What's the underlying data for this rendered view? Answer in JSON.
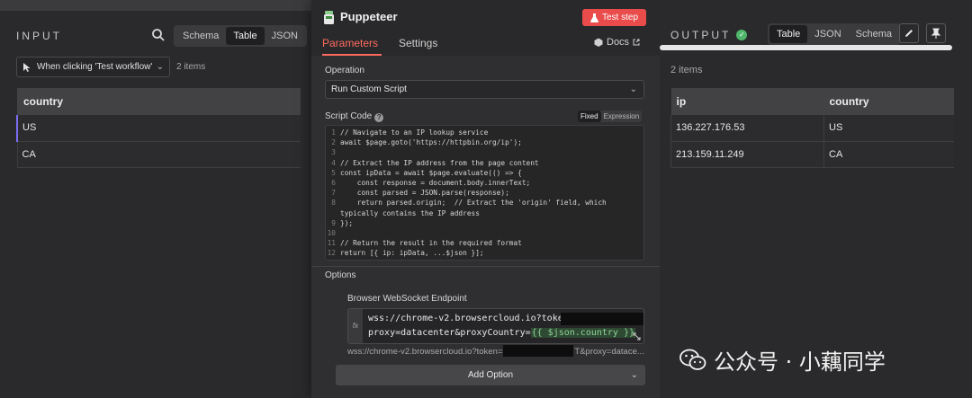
{
  "input": {
    "title": "INPUT",
    "view_tabs": [
      "Schema",
      "Table",
      "JSON"
    ],
    "active_view": "Table",
    "trigger_select": "When clicking 'Test workflow'",
    "items_count": "2 items",
    "columns": [
      "country"
    ],
    "rows": [
      [
        "US"
      ],
      [
        "CA"
      ]
    ]
  },
  "node": {
    "title": "Puppeteer",
    "test_button": "Test step",
    "tabs": {
      "parameters": "Parameters",
      "settings": "Settings"
    },
    "active_tab": "Parameters",
    "docs": "Docs",
    "operation_label": "Operation",
    "operation_value": "Run Custom Script",
    "script_label": "Script Code",
    "mode_toggle": {
      "fixed": "Fixed",
      "expression": "Expression"
    },
    "active_mode": "Fixed",
    "code_lines": [
      "// Navigate to an IP lookup service",
      "await $page.goto('https://httpbin.org/ip');",
      "",
      "// Extract the IP address from the page content",
      "const ipData = await $page.evaluate(() => {",
      "    const response = document.body.innerText;",
      "    const parsed = JSON.parse(response);",
      "    return parsed.origin;  // Extract the 'origin' field, which",
      "typically contains the IP address",
      "});",
      "",
      "// Return the result in the required format",
      "return [{ ip: ipData, ...$json }];"
    ],
    "line_numbers": [
      "1",
      "2",
      "3",
      "4",
      "5",
      "6",
      "7",
      "8",
      "",
      "9",
      "10",
      "11",
      "12"
    ],
    "options_label": "Options",
    "ws_label": "Browser WebSocket Endpoint",
    "ws_line1": "wss://chrome-v2.browsercloud.io?token=",
    "ws_line2_prefix": "proxy=datacenter&proxyCountry=",
    "ws_line2_token": "{{ $json.country }}",
    "ws_preview_a": "wss://chrome-v2.browsercloud.io?token=",
    "ws_preview_b": "T&proxy=datace...",
    "add_option": "Add Option"
  },
  "output": {
    "title": "OUTPUT",
    "view_tabs": [
      "Table",
      "JSON",
      "Schema"
    ],
    "active_view": "Table",
    "items_count": "2 items",
    "columns": [
      "ip",
      "country"
    ],
    "rows": [
      [
        "136.227.176.53",
        "US"
      ],
      [
        "213.159.11.249",
        "CA"
      ]
    ]
  },
  "watermark": "公众号 · 小藕同学",
  "colors": {
    "accent": "#ff6b5e",
    "test_button": "#ea4b4b",
    "success": "#4fb66b"
  }
}
